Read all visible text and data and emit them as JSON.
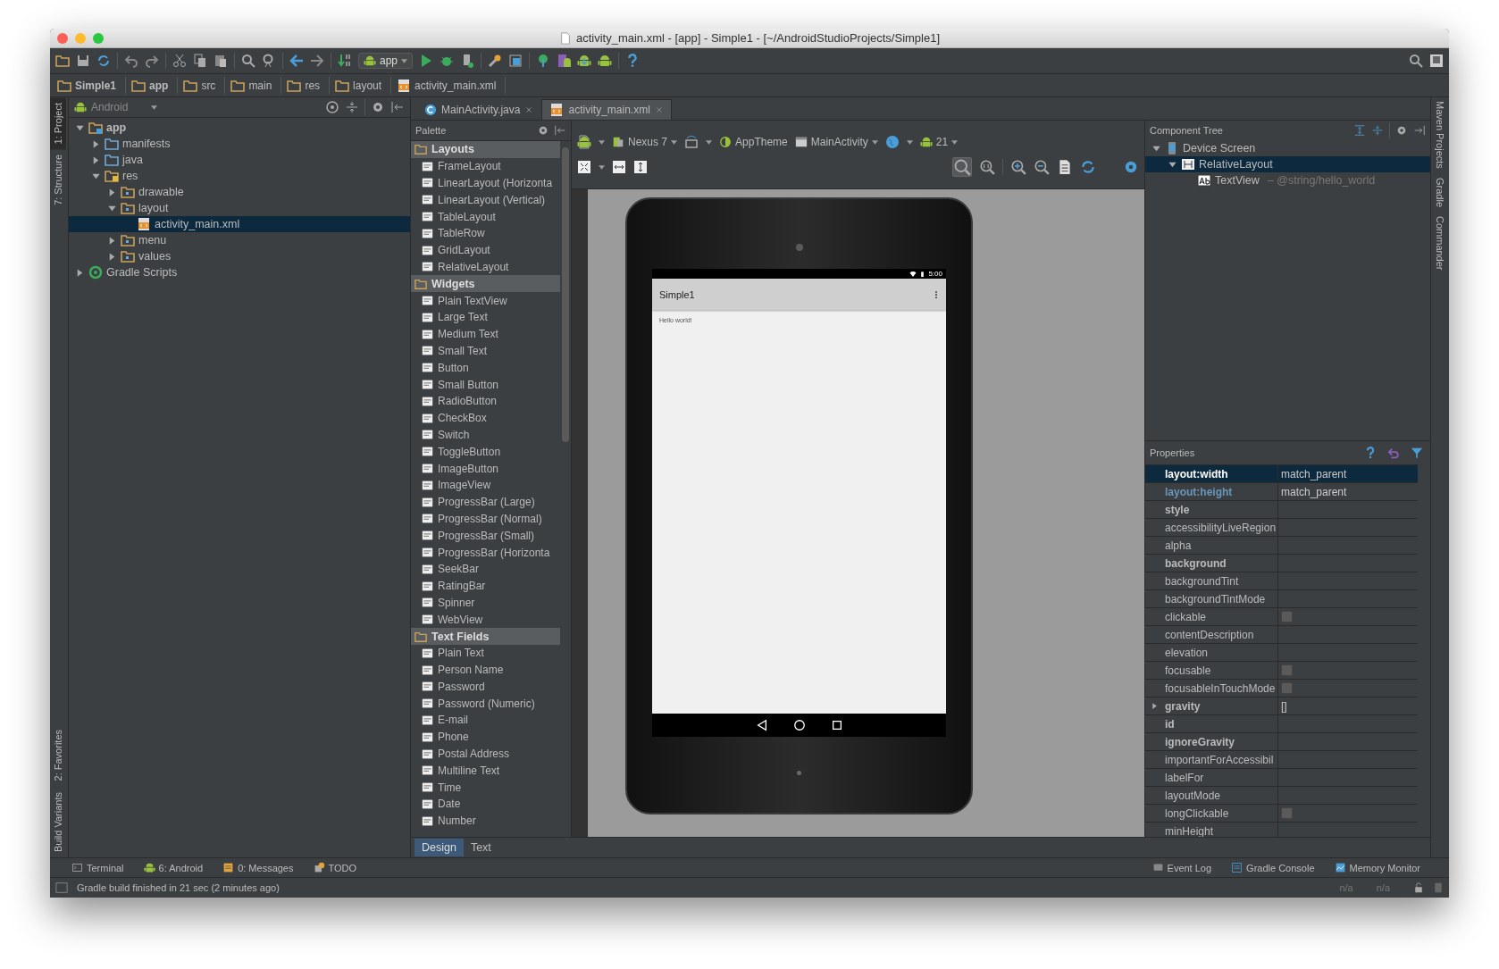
{
  "window": {
    "title": "activity_main.xml - [app] - Simple1 - [~/AndroidStudioProjects/Simple1]"
  },
  "toolbar": {
    "run_config": "app"
  },
  "breadcrumbs": [
    "Simple1",
    "app",
    "src",
    "main",
    "res",
    "layout",
    "activity_main.xml"
  ],
  "left_tool_tabs_top": [
    {
      "label": "1: Project",
      "selected": true
    },
    {
      "label": "7: Structure",
      "selected": false
    }
  ],
  "left_tool_tabs_bottom": [
    {
      "label": "2: Favorites",
      "selected": false
    },
    {
      "label": "Build Variants",
      "selected": false
    }
  ],
  "right_tool_tabs": [
    "Maven Projects",
    "Gradle",
    "Commander"
  ],
  "project_panel": {
    "view": "Android",
    "tree": [
      {
        "label": "app",
        "kind": "module",
        "expanded": true,
        "selected": false,
        "children": [
          {
            "label": "manifests",
            "kind": "source",
            "expanded": false,
            "selected": false
          },
          {
            "label": "java",
            "kind": "source",
            "expanded": false,
            "selected": false
          },
          {
            "label": "res",
            "kind": "resources",
            "expanded": true,
            "selected": false,
            "children": [
              {
                "label": "drawable",
                "kind": "resdir",
                "expanded": false,
                "selected": false
              },
              {
                "label": "layout",
                "kind": "resdir",
                "expanded": true,
                "selected": false,
                "children": [
                  {
                    "label": "activity_main.xml",
                    "kind": "xml",
                    "selected": true
                  }
                ]
              },
              {
                "label": "menu",
                "kind": "resdir",
                "expanded": false,
                "selected": false
              },
              {
                "label": "values",
                "kind": "resdir",
                "expanded": false,
                "selected": false
              }
            ]
          }
        ]
      },
      {
        "label": "Gradle Scripts",
        "kind": "gradle",
        "expanded": false,
        "selected": false
      }
    ]
  },
  "editor_tabs": [
    {
      "label": "MainActivity.java",
      "kind": "java",
      "selected": false
    },
    {
      "label": "activity_main.xml",
      "kind": "xml",
      "selected": true
    }
  ],
  "designer_toolbar": {
    "device": "Nexus 7",
    "theme": "AppTheme",
    "activity": "MainActivity",
    "api": "21"
  },
  "palette": {
    "title": "Palette",
    "sections": [
      {
        "title": "Layouts",
        "items": [
          "FrameLayout",
          "LinearLayout (Horizonta",
          "LinearLayout (Vertical)",
          "TableLayout",
          "TableRow",
          "GridLayout",
          "RelativeLayout"
        ]
      },
      {
        "title": "Widgets",
        "items": [
          "Plain TextView",
          "Large Text",
          "Medium Text",
          "Small Text",
          "Button",
          "Small Button",
          "RadioButton",
          "CheckBox",
          "Switch",
          "ToggleButton",
          "ImageButton",
          "ImageView",
          "ProgressBar (Large)",
          "ProgressBar (Normal)",
          "ProgressBar (Small)",
          "ProgressBar (Horizonta",
          "SeekBar",
          "RatingBar",
          "Spinner",
          "WebView"
        ]
      },
      {
        "title": "Text Fields",
        "items": [
          "Plain Text",
          "Person Name",
          "Password",
          "Password (Numeric)",
          "E-mail",
          "Phone",
          "Postal Address",
          "Multiline Text",
          "Time",
          "Date",
          "Number"
        ]
      }
    ]
  },
  "phone": {
    "status_time": "5:00",
    "app_title": "Simple1",
    "body_text": "Hello world!"
  },
  "component_tree": {
    "title": "Component Tree",
    "tree": [
      {
        "label": "Device Screen",
        "kind": "device",
        "expanded": true,
        "selected": false,
        "children": [
          {
            "label": "RelativeLayout",
            "kind": "layout",
            "expanded": true,
            "selected": true,
            "children": [
              {
                "label": "TextView",
                "detail": "– @string/hello_world",
                "kind": "text",
                "selected": false
              }
            ]
          }
        ]
      }
    ]
  },
  "properties": {
    "title": "Properties",
    "rows": [
      {
        "name": "layout:width",
        "value": "match_parent",
        "important": true,
        "modified": false,
        "kind": "text",
        "selected": true
      },
      {
        "name": "layout:height",
        "value": "match_parent",
        "important": true,
        "modified": true,
        "kind": "text",
        "selected": false
      },
      {
        "name": "style",
        "important": true,
        "modified": false,
        "kind": "text",
        "selected": false
      },
      {
        "name": "accessibilityLiveRegion",
        "important": false,
        "modified": false,
        "kind": "text",
        "selected": false
      },
      {
        "name": "alpha",
        "important": false,
        "modified": false,
        "kind": "text",
        "selected": false
      },
      {
        "name": "background",
        "important": true,
        "modified": false,
        "kind": "text",
        "selected": false
      },
      {
        "name": "backgroundTint",
        "important": false,
        "modified": false,
        "kind": "text",
        "selected": false
      },
      {
        "name": "backgroundTintMode",
        "important": false,
        "modified": false,
        "kind": "text",
        "selected": false
      },
      {
        "name": "clickable",
        "important": false,
        "modified": false,
        "kind": "checkbox",
        "checked": false,
        "selected": false
      },
      {
        "name": "contentDescription",
        "important": false,
        "modified": false,
        "kind": "text",
        "selected": false
      },
      {
        "name": "elevation",
        "important": false,
        "modified": false,
        "kind": "text",
        "selected": false
      },
      {
        "name": "focusable",
        "important": false,
        "modified": false,
        "kind": "checkbox",
        "checked": false,
        "selected": false
      },
      {
        "name": "focusableInTouchMode",
        "important": false,
        "modified": false,
        "kind": "checkbox",
        "checked": false,
        "selected": false
      },
      {
        "name": "gravity",
        "value": "[]",
        "important": true,
        "modified": false,
        "kind": "flags",
        "selected": false
      },
      {
        "name": "id",
        "important": true,
        "modified": false,
        "kind": "text",
        "selected": false
      },
      {
        "name": "ignoreGravity",
        "important": true,
        "modified": false,
        "kind": "text",
        "selected": false
      },
      {
        "name": "importantForAccessibil",
        "important": false,
        "modified": false,
        "kind": "text",
        "selected": false
      },
      {
        "name": "labelFor",
        "important": false,
        "modified": false,
        "kind": "text",
        "selected": false
      },
      {
        "name": "layoutMode",
        "important": false,
        "modified": false,
        "kind": "text",
        "selected": false
      },
      {
        "name": "longClickable",
        "important": false,
        "modified": false,
        "kind": "checkbox",
        "checked": false,
        "selected": false
      },
      {
        "name": "minHeight",
        "important": false,
        "modified": false,
        "kind": "text",
        "selected": false
      }
    ]
  },
  "design_tabs": [
    {
      "label": "Design",
      "selected": true
    },
    {
      "label": "Text",
      "selected": false
    }
  ],
  "bottom_tools": {
    "left": [
      "Terminal",
      "6: Android",
      "0: Messages",
      "TODO"
    ],
    "right": [
      "Event Log",
      "Gradle Console",
      "Memory Monitor"
    ]
  },
  "status_bar": {
    "message": "Gradle build finished in 21 sec (2 minutes ago)",
    "indicators": [
      "n/a",
      "n/a"
    ]
  }
}
